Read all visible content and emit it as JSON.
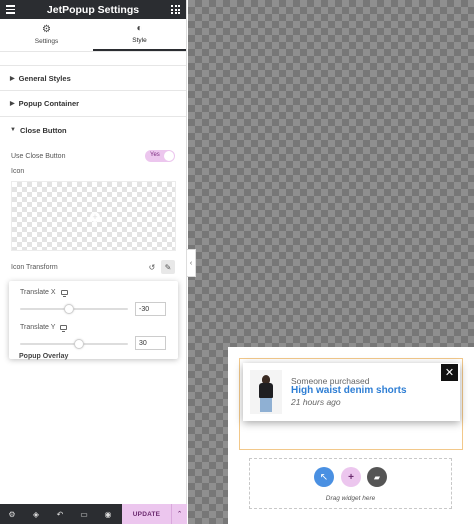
{
  "header": {
    "title": "JetPopup Settings"
  },
  "tabs": [
    {
      "label": "Settings",
      "icon": "gear-icon"
    },
    {
      "label": "Style",
      "icon": "contrast-icon"
    }
  ],
  "sections": {
    "general": "General Styles",
    "container": "Popup Container",
    "close": "Close Button",
    "overlay": "Popup Overlay"
  },
  "close_button": {
    "use_label": "Use Close Button",
    "toggle_value": "Yes",
    "icon_label": "Icon",
    "transform_label": "Icon Transform"
  },
  "transform": {
    "translate_x": {
      "label": "Translate X",
      "value": "-30",
      "slider_fraction": 0.45
    },
    "translate_y": {
      "label": "Translate Y",
      "value": "30",
      "slider_fraction": 0.55
    }
  },
  "footer": {
    "update_label": "UPDATE"
  },
  "preview": {
    "notification": {
      "line1": "Someone purchased",
      "line2": "High waist denim shorts",
      "line3": "21 hours ago"
    },
    "drop_label": "Drag widget here"
  },
  "colors": {
    "accent": "#ecc6ee",
    "link": "#2e7ed4",
    "dark_bar": "#2b2d31"
  }
}
